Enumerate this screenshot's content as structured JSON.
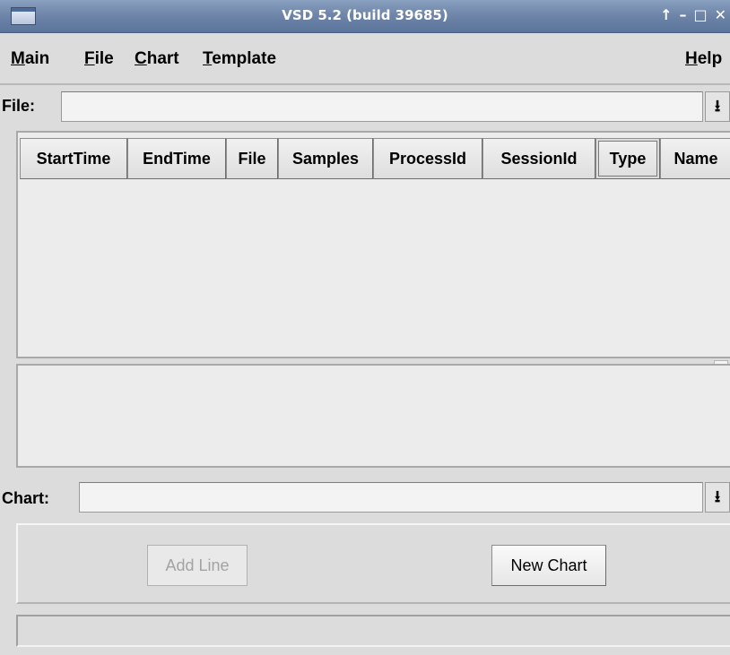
{
  "window": {
    "title": "VSD 5.2 (build 39685)",
    "controls": {
      "up": "↑",
      "minimize": "–",
      "maximize": "□",
      "close": "✕"
    }
  },
  "menu": {
    "items": [
      {
        "label": "Main",
        "mnemonic": "M",
        "rest": "ain"
      },
      {
        "label": "File",
        "mnemonic": "F",
        "rest": "ile"
      },
      {
        "label": "Chart",
        "mnemonic": "C",
        "rest": "hart"
      },
      {
        "label": "Template",
        "mnemonic": "T",
        "rest": "emplate"
      }
    ],
    "help": {
      "label": "Help",
      "mnemonic": "H",
      "rest": "elp"
    }
  },
  "file_row": {
    "label": "File:",
    "value": "",
    "dropdown_icon": "download-arrow-icon",
    "dropdown_glyph": "⭳"
  },
  "table": {
    "columns": [
      "StartTime",
      "EndTime",
      "File",
      "Samples",
      "ProcessId",
      "SessionId",
      "Type",
      "Name"
    ],
    "selected_column": "Type",
    "rows": []
  },
  "chart_row": {
    "label": "Chart:",
    "value": "",
    "dropdown_icon": "download-arrow-icon",
    "dropdown_glyph": "⭳"
  },
  "buttons": {
    "add_line": {
      "label": "Add Line",
      "enabled": false
    },
    "new_chart": {
      "label": "New Chart",
      "enabled": true
    }
  },
  "status": {
    "text": ""
  },
  "colors": {
    "titlebar": "#6f86aa",
    "background": "#dcdcdc",
    "panel": "#ececec",
    "disabled_text": "#a3a3a3"
  }
}
